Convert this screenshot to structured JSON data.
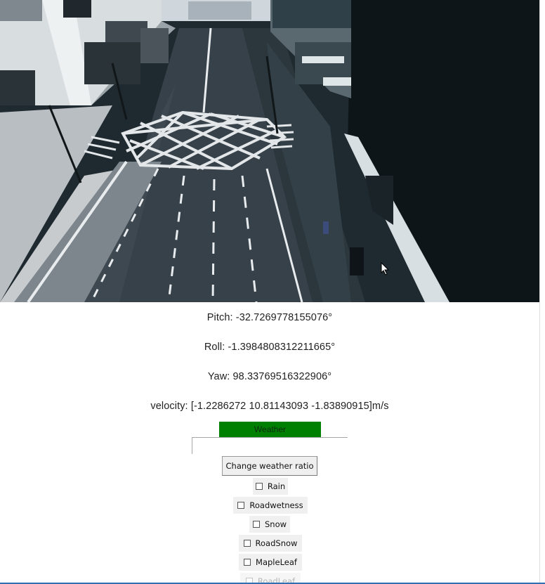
{
  "telemetry": {
    "pitch": "Pitch: -32.7269778155076°",
    "roll": "Roll: -1.3984808312211665°",
    "yaw": "Yaw: 98.33769516322906°",
    "velocity": "velocity: [-1.2286272  10.81143093 -1.83890915]m/s"
  },
  "weather": {
    "header": "Weather",
    "change_button": "Change weather ratio",
    "options": [
      {
        "label": "Rain",
        "checked": false
      },
      {
        "label": "Roadwetness",
        "checked": false
      },
      {
        "label": "Snow",
        "checked": false
      },
      {
        "label": "RoadSnow",
        "checked": false
      },
      {
        "label": "MapleLeaf",
        "checked": false
      },
      {
        "label": "RoadLeaf",
        "checked": false
      }
    ]
  },
  "colors": {
    "weather_header": "#008000",
    "accent_line": "#2e6fb6"
  }
}
